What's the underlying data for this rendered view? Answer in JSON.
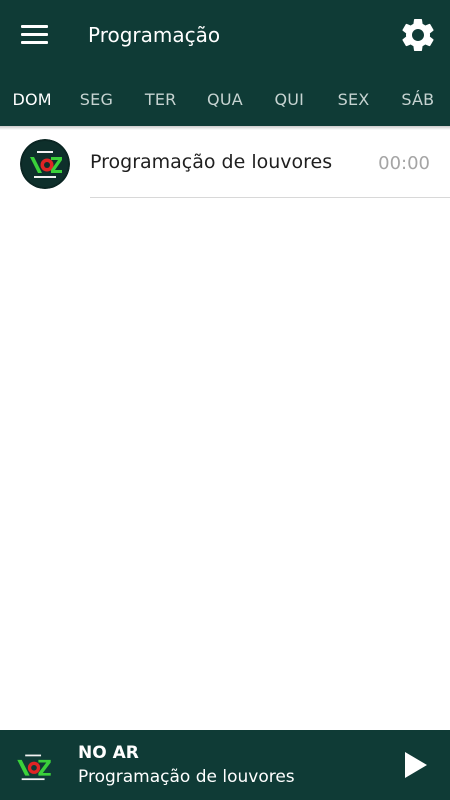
{
  "header": {
    "title": "Programação",
    "menu_icon": "hamburger-menu-icon",
    "settings_icon": "gear-icon"
  },
  "tabs": [
    {
      "label": "DOM",
      "active": true
    },
    {
      "label": "SEG",
      "active": false
    },
    {
      "label": "TER",
      "active": false
    },
    {
      "label": "QUA",
      "active": false
    },
    {
      "label": "QUI",
      "active": false
    },
    {
      "label": "SEX",
      "active": false
    },
    {
      "label": "SÁB",
      "active": false
    }
  ],
  "schedule": [
    {
      "title": "Programação de louvores",
      "time": "00:00",
      "logo_icon": "station-logo-icon"
    }
  ],
  "player": {
    "status": "NO AR",
    "show": "Programação de louvores",
    "play_icon": "play-icon"
  },
  "colors": {
    "primary": "#0f3b36",
    "text": "#1f1f1f",
    "muted": "#a5a5a5",
    "tab_inactive": "#c6d3d1"
  }
}
